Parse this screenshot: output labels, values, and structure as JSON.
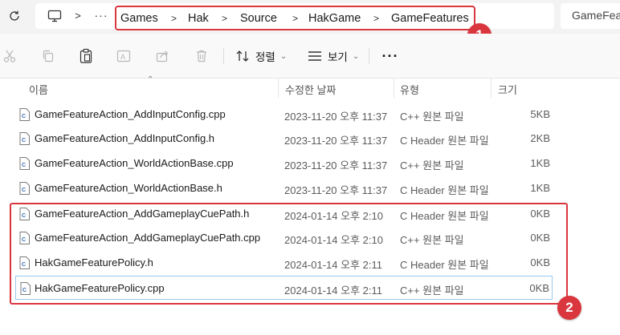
{
  "address_bar": {
    "breadcrumbs": [
      "Games",
      "Hak",
      "Source",
      "HakGame",
      "GameFeatures"
    ],
    "search_placeholder": "GameFeatures 검색",
    "search_visible_text": "GameFea",
    "more_glyph": "···",
    "chevron_glyph": ">"
  },
  "annotations": {
    "badge1": "1",
    "badge2": "2"
  },
  "toolbar": {
    "sort_label": "정렬",
    "view_label": "보기",
    "more_glyph": "···"
  },
  "columns": {
    "name": "이름",
    "date": "수정한 날짜",
    "type": "유형",
    "size": "크기"
  },
  "files": [
    {
      "name": "GameFeatureAction_AddInputConfig.cpp",
      "date": "2023-11-20 오후 11:37",
      "type": "C++ 원본 파일",
      "size": "5KB"
    },
    {
      "name": "GameFeatureAction_AddInputConfig.h",
      "date": "2023-11-20 오후 11:37",
      "type": "C Header 원본 파일",
      "size": "2KB"
    },
    {
      "name": "GameFeatureAction_WorldActionBase.cpp",
      "date": "2023-11-20 오후 11:37",
      "type": "C++ 원본 파일",
      "size": "1KB"
    },
    {
      "name": "GameFeatureAction_WorldActionBase.h",
      "date": "2023-11-20 오후 11:37",
      "type": "C Header 원본 파일",
      "size": "1KB"
    },
    {
      "name": "GameFeatureAction_AddGameplayCuePath.h",
      "date": "2024-01-14 오후 2:10",
      "type": "C Header 원본 파일",
      "size": "0KB"
    },
    {
      "name": "GameFeatureAction_AddGameplayCuePath.cpp",
      "date": "2024-01-14 오후 2:10",
      "type": "C++ 원본 파일",
      "size": "0KB"
    },
    {
      "name": "HakGameFeaturePolicy.h",
      "date": "2024-01-14 오후 2:11",
      "type": "C Header 원본 파일",
      "size": "0KB"
    },
    {
      "name": "HakGameFeaturePolicy.cpp",
      "date": "2024-01-14 오후 2:11",
      "type": "C++ 원본 파일",
      "size": "0KB"
    }
  ],
  "colors": {
    "highlight_red": "#d9363e",
    "selection_border": "#99c9ef"
  }
}
